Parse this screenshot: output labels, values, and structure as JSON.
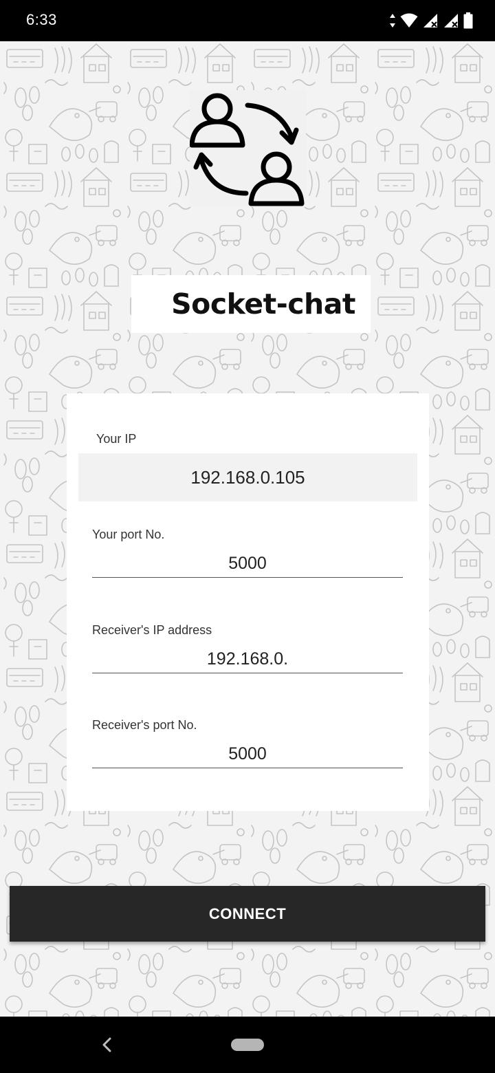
{
  "status_bar": {
    "time": "6:33",
    "icons": [
      "data-arrows-icon",
      "wifi-icon",
      "signal-x-icon",
      "signal-x-icon",
      "battery-icon"
    ]
  },
  "app": {
    "title": "Socket-chat",
    "logo_icon": "user-exchange-icon",
    "accent_color": "#272727"
  },
  "form": {
    "your_ip": {
      "label": "Your IP",
      "value": "192.168.0.105"
    },
    "your_port": {
      "label": "Your port No.",
      "value": "5000"
    },
    "receiver_ip": {
      "label": "Receiver's IP address",
      "value": "192.168.0."
    },
    "receiver_port": {
      "label": "Receiver's port No.",
      "value": "5000"
    }
  },
  "actions": {
    "connect_label": "CONNECT"
  },
  "nav_bar": {
    "back_icon": "back-chevron-icon",
    "home_icon": "home-pill-icon"
  }
}
